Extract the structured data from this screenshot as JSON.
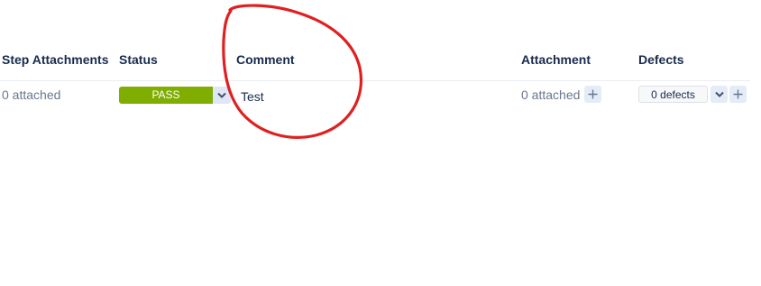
{
  "columns": {
    "step_attachments": "Step Attachments",
    "status": "Status",
    "comment": "Comment",
    "attachment": "Attachment",
    "defects": "Defects"
  },
  "row": {
    "step_attachments_value": "0 attached",
    "status_value": "PASS",
    "comment_value": "Test",
    "attachment_value": "0 attached",
    "defects_value": "0 defects"
  },
  "colors": {
    "pass": "#7fad00",
    "annotation": "#e02020",
    "text_dark": "#172b4d",
    "text_muted": "#6b778c"
  },
  "icons": {
    "status_dropdown": "chevron-down-icon",
    "add_attachment": "plus-icon",
    "defects_dropdown": "chevron-down-icon",
    "add_defect": "plus-icon"
  }
}
